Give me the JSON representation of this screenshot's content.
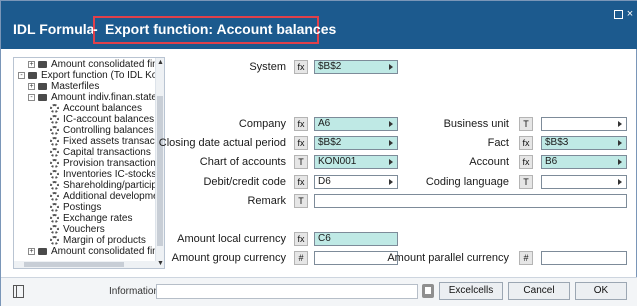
{
  "window": {
    "app_title": "IDL Formula",
    "separator": "-",
    "function_title": "Export function: Account balances",
    "maximize_glyph": "",
    "close_glyph": "×"
  },
  "tree": {
    "items": [
      {
        "label": "Amount consolidated finan",
        "icon": "folder-icon",
        "toggle": "+"
      },
      {
        "label": "Export function (To IDL Konsis",
        "icon": "folder-icon",
        "toggle": "-"
      },
      {
        "label": "Masterfiles",
        "icon": "folder-icon",
        "toggle": "+"
      },
      {
        "label": "Amount indiv.finan.stateme",
        "icon": "folder-icon",
        "toggle": "-"
      },
      {
        "label": "Account balances",
        "icon": "gear-icon"
      },
      {
        "label": "IC-account balances",
        "icon": "gear-icon"
      },
      {
        "label": "Controlling balances",
        "icon": "gear-icon"
      },
      {
        "label": "Fixed assets transactio",
        "icon": "gear-icon"
      },
      {
        "label": "Capital transactions",
        "icon": "gear-icon"
      },
      {
        "label": "Provision transactions",
        "icon": "gear-icon"
      },
      {
        "label": "Inventories IC-stocks",
        "icon": "gear-icon"
      },
      {
        "label": "Shareholding/participati",
        "icon": "gear-icon"
      },
      {
        "label": "Additional development",
        "icon": "gear-icon"
      },
      {
        "label": "Postings",
        "icon": "gear-icon"
      },
      {
        "label": "Exchange rates",
        "icon": "gear-icon"
      },
      {
        "label": "Vouchers",
        "icon": "gear-icon"
      },
      {
        "label": "Margin of products",
        "icon": "gear-icon"
      },
      {
        "label": "Amount consolidated finan",
        "icon": "folder-icon",
        "toggle": "+"
      }
    ]
  },
  "form": {
    "system": {
      "label": "System",
      "btn": "fx",
      "value": "$B$2"
    },
    "company": {
      "label": "Company",
      "btn": "fx",
      "value": "A6"
    },
    "business_unit": {
      "label": "Business unit",
      "btn": "T",
      "value": ""
    },
    "closing_date": {
      "label": "Closing date actual period",
      "btn": "fx",
      "value": "$B$2"
    },
    "fact": {
      "label": "Fact",
      "btn": "fx",
      "value": "$B$3"
    },
    "chart_of_accounts": {
      "label": "Chart of accounts",
      "btn": "T",
      "value": "KON001"
    },
    "account": {
      "label": "Account",
      "btn": "fx",
      "value": "B6"
    },
    "debit_credit": {
      "label": "Debit/credit code",
      "btn": "fx",
      "value": "D6"
    },
    "coding_language": {
      "label": "Coding language",
      "btn": "T",
      "value": ""
    },
    "remark": {
      "label": "Remark",
      "btn": "T",
      "value": ""
    },
    "amount_local": {
      "label": "Amount local currency",
      "btn": "fx",
      "value": "C6"
    },
    "amount_group": {
      "label": "Amount group currency",
      "btn": "#",
      "value": ""
    },
    "amount_parallel": {
      "label": "Amount parallel currency",
      "btn": "#",
      "value": ""
    }
  },
  "footer": {
    "information_label": "Information",
    "information_value": "",
    "excelcells_label": "Excelcells",
    "cancel_label": "Cancel",
    "ok_label": "OK"
  },
  "colors": {
    "title_bar": "#1c5a8e",
    "highlight_border": "#e0404a",
    "formula_field": "#bfe9e5"
  }
}
